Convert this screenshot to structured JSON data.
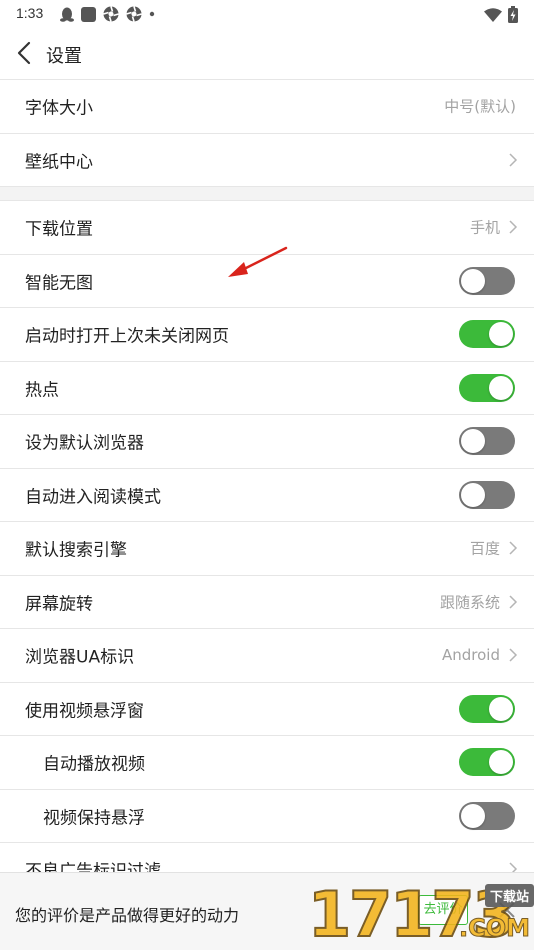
{
  "status_bar": {
    "time": "1:33",
    "left_icons": [
      "qq-penguin-icon",
      "app-square-icon",
      "aperture-icon",
      "aperture-icon",
      "dot-icon"
    ],
    "right_icons": [
      "wifi-icon",
      "battery-charging-icon"
    ]
  },
  "app_bar": {
    "title": "设置"
  },
  "settings": {
    "font_size": {
      "label": "字体大小",
      "value": "中号(默认)"
    },
    "wallpaper": {
      "label": "壁纸中心"
    },
    "download_location": {
      "label": "下载位置",
      "value": "手机"
    },
    "smart_no_image": {
      "label": "智能无图",
      "on": false
    },
    "restore_tabs": {
      "label": "启动时打开上次未关闭网页",
      "on": true
    },
    "hot_spots": {
      "label": "热点",
      "on": true
    },
    "default_browser": {
      "label": "设为默认浏览器",
      "on": false
    },
    "auto_reading_mode": {
      "label": "自动进入阅读模式",
      "on": false
    },
    "search_engine": {
      "label": "默认搜索引擎",
      "value": "百度"
    },
    "screen_rotation": {
      "label": "屏幕旋转",
      "value": "跟随系统"
    },
    "user_agent": {
      "label": "浏览器UA标识",
      "value": "Android"
    },
    "floating_video": {
      "label": "使用视频悬浮窗",
      "on": true
    },
    "autoplay_video": {
      "label": "自动播放视频",
      "on": true
    },
    "keep_floating": {
      "label": "视频保持悬浮",
      "on": false
    },
    "ad_filter": {
      "label": "不良广告标识过滤"
    }
  },
  "rating_bar": {
    "text": "您的评价是产品做得更好的动力",
    "button_label": "去评价"
  },
  "watermark": {
    "digits": "17173",
    "tag": "下载站",
    "suffix": ".COM"
  },
  "colors": {
    "toggle_on": "#3cba3a",
    "toggle_off": "#7a7a7a",
    "annotation_arrow": "#d9241c",
    "watermark": "#f3b41b"
  }
}
